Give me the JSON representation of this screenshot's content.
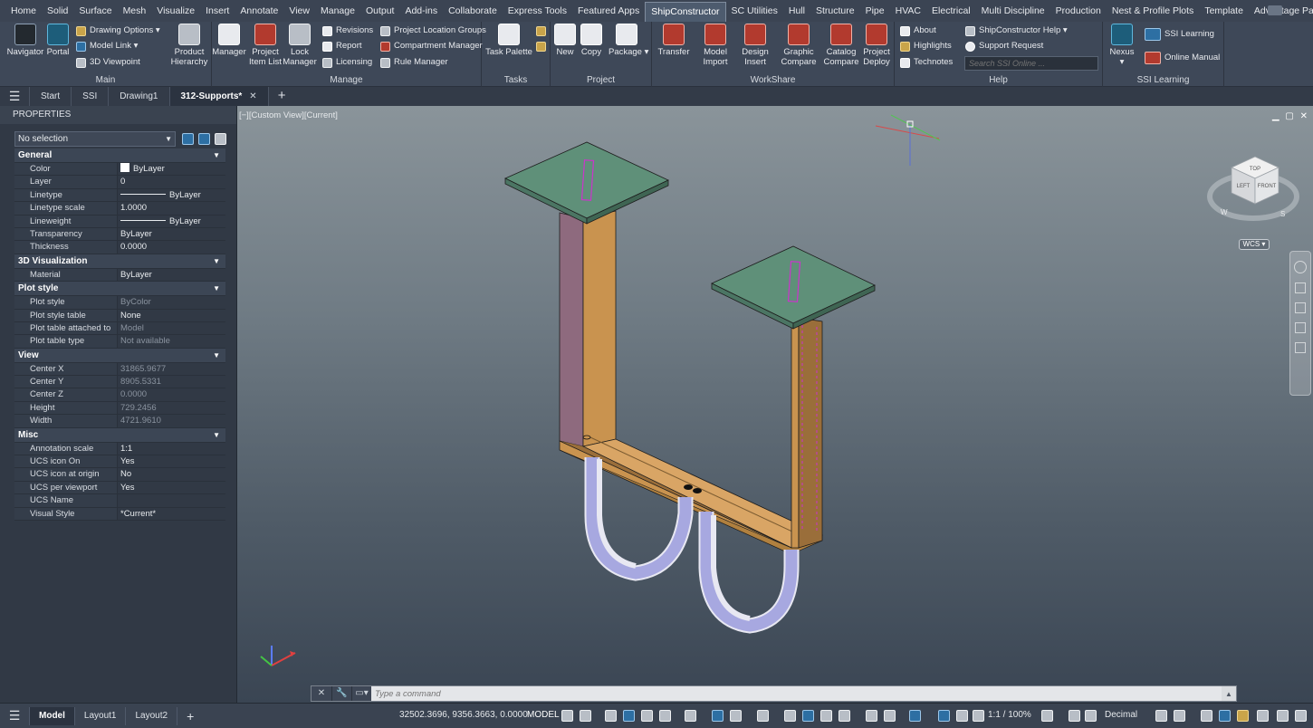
{
  "ribbon_tabs": [
    "Home",
    "Solid",
    "Surface",
    "Mesh",
    "Visualize",
    "Insert",
    "Annotate",
    "View",
    "Manage",
    "Output",
    "Add-ins",
    "Collaborate",
    "Express Tools",
    "Featured Apps",
    "ShipConstructor",
    "SC Utilities",
    "Hull",
    "Structure",
    "Pipe",
    "HVAC",
    "Electrical",
    "Multi Discipline",
    "Production",
    "Nest & Profile Plots",
    "Template",
    "Advantage Pack"
  ],
  "active_ribbon_tab": "ShipConstructor",
  "ribbon": {
    "main": {
      "title": "Main",
      "navigator": "Navigator",
      "portal": "Portal",
      "drawing_options": "Drawing Options",
      "model_link": "Model Link",
      "viewpoint": "3D Viewpoint"
    },
    "product_hierarchy": {
      "line1": "Product",
      "line2": "Hierarchy"
    },
    "manage": {
      "title": "Manage",
      "manager": "Manager",
      "project_item_list_1": "Project",
      "project_item_list_2": "Item List",
      "lock_manager_1": "Lock",
      "lock_manager_2": "Manager",
      "revisions": "Revisions",
      "report": "Report",
      "licensing": "Licensing",
      "project_location_groups": "Project Location Groups",
      "compartment_manager": "Compartment Manager",
      "rule_manager": "Rule Manager"
    },
    "tasks": {
      "title": "Tasks",
      "task_palette": "Task Palette"
    },
    "project": {
      "title": "Project",
      "new": "New",
      "copy": "Copy",
      "package": "Package"
    },
    "workshare": {
      "title": "WorkShare",
      "transfer": "Transfer",
      "model_import_1": "Model",
      "model_import_2": "Import",
      "design_insert_1": "Design",
      "design_insert_2": "Insert",
      "graphic_compare_1": "Graphic",
      "graphic_compare_2": "Compare",
      "catalog_compare_1": "Catalog",
      "catalog_compare_2": "Compare",
      "project_deploy_1": "Project",
      "project_deploy_2": "Deploy"
    },
    "help": {
      "title": "Help",
      "about": "About",
      "highlights": "Highlights",
      "technotes": "Technotes",
      "sc_help": "ShipConstructor Help",
      "support_request": "Support Request",
      "search_placeholder": "Search SSI Online ..."
    },
    "ssi_learning": {
      "title": "SSI Learning",
      "nexus": "Nexus",
      "ssi_learning": "SSI Learning",
      "online_manual": "Online Manual"
    }
  },
  "file_tabs": [
    {
      "label": "Start"
    },
    {
      "label": "SSI"
    },
    {
      "label": "Drawing1"
    },
    {
      "label": "312-Supports*"
    }
  ],
  "properties": {
    "title": "PROPERTIES",
    "selection": "No selection",
    "sections": {
      "general": {
        "title": "General",
        "rows": [
          {
            "k": "Color",
            "v": "ByLayer"
          },
          {
            "k": "Layer",
            "v": "0"
          },
          {
            "k": "Linetype",
            "v": "ByLayer"
          },
          {
            "k": "Linetype scale",
            "v": "1.0000"
          },
          {
            "k": "Lineweight",
            "v": "ByLayer"
          },
          {
            "k": "Transparency",
            "v": "ByLayer"
          },
          {
            "k": "Thickness",
            "v": "0.0000"
          }
        ]
      },
      "viz": {
        "title": "3D Visualization",
        "rows": [
          {
            "k": "Material",
            "v": "ByLayer"
          }
        ]
      },
      "plot": {
        "title": "Plot style",
        "rows": [
          {
            "k": "Plot style",
            "v": "ByColor"
          },
          {
            "k": "Plot style table",
            "v": "None"
          },
          {
            "k": "Plot table attached to",
            "v": "Model"
          },
          {
            "k": "Plot table type",
            "v": "Not available"
          }
        ]
      },
      "view": {
        "title": "View",
        "rows": [
          {
            "k": "Center X",
            "v": "31865.9677"
          },
          {
            "k": "Center Y",
            "v": "8905.5331"
          },
          {
            "k": "Center Z",
            "v": "0.0000"
          },
          {
            "k": "Height",
            "v": "729.2456"
          },
          {
            "k": "Width",
            "v": "4721.9610"
          }
        ]
      },
      "misc": {
        "title": "Misc",
        "rows": [
          {
            "k": "Annotation scale",
            "v": "1:1"
          },
          {
            "k": "UCS icon On",
            "v": "Yes"
          },
          {
            "k": "UCS icon at origin",
            "v": "No"
          },
          {
            "k": "UCS per viewport",
            "v": "Yes"
          },
          {
            "k": "UCS Name",
            "v": ""
          },
          {
            "k": "Visual Style",
            "v": "*Current*"
          }
        ]
      }
    }
  },
  "viewport": {
    "label": "[−][Custom View][Current]",
    "viewcube_top": "TOP",
    "viewcube_left": "LEFT",
    "viewcube_front": "FRONT",
    "compass_w": "W",
    "compass_s": "S",
    "wcs": "WCS"
  },
  "command": {
    "placeholder": "Type a command"
  },
  "status": {
    "layouts": [
      {
        "label": "Model"
      },
      {
        "label": "Layout1"
      },
      {
        "label": "Layout2"
      }
    ],
    "coords": "32502.3696, 9356.3663, 0.0000",
    "mode": "MODEL",
    "scale": "1:1 / 100%",
    "units": "Decimal"
  },
  "colors": {
    "plate": "#5f9079",
    "beam": "#c9934f",
    "beam_dark": "#9a6e3a",
    "flange_pink": "#8e6a7e",
    "strap": "#a7a8e0",
    "accent": "#cc33cc"
  }
}
